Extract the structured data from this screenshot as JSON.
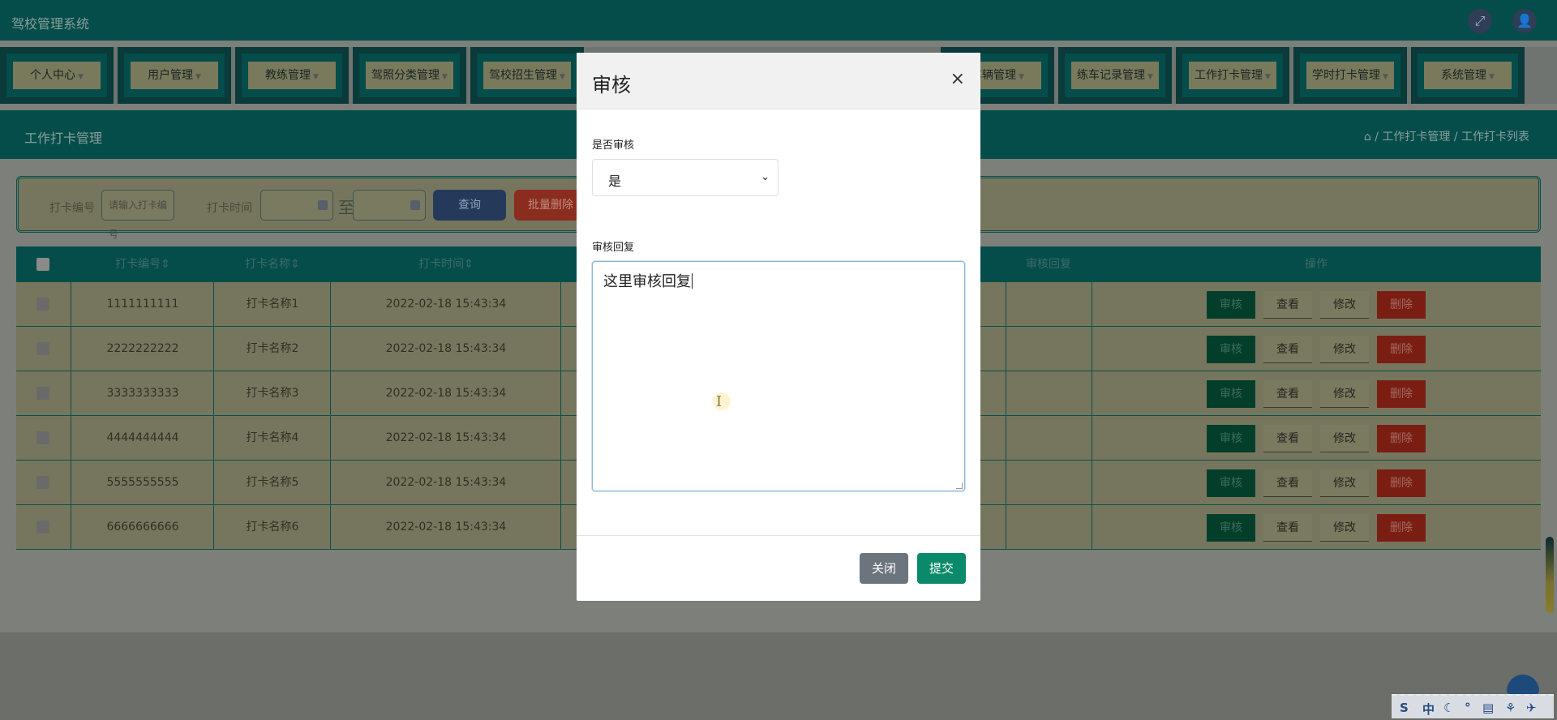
{
  "app": {
    "title": "驾校管理系统"
  },
  "topbar": {
    "fullscreen_icon": "⤢",
    "user_icon": "👤"
  },
  "nav": [
    {
      "label": "个人中心"
    },
    {
      "label": "用户管理"
    },
    {
      "label": "教练管理"
    },
    {
      "label": "驾照分类管理"
    },
    {
      "label": "驾校招生管理"
    },
    {
      "label": "车辆管理"
    },
    {
      "label": "练车记录管理"
    },
    {
      "label": "工作打卡管理"
    },
    {
      "label": "学时打卡管理"
    },
    {
      "label": "系统管理"
    }
  ],
  "page": {
    "title": "工作打卡管理",
    "breadcrumb_home_icon": "⌂",
    "breadcrumb_sep": "/",
    "breadcrumb_1": "工作打卡管理",
    "breadcrumb_2": "工作打卡列表"
  },
  "search": {
    "id_label": "打卡编号",
    "id_placeholder": "请输入打卡编号",
    "time_label": "打卡时间",
    "to_text": "至",
    "query_button": "查询",
    "batch_delete_button": "批量删除"
  },
  "table": {
    "headers": {
      "id": "打卡编号",
      "name": "打卡名称",
      "time": "打卡时间",
      "reply": "审核回复",
      "actions": "操作"
    },
    "sort_glyph": "⇕",
    "rows": [
      {
        "id": "1111111111",
        "name": "打卡名称1",
        "time": "2022-02-18 15:43:34"
      },
      {
        "id": "2222222222",
        "name": "打卡名称2",
        "time": "2022-02-18 15:43:34"
      },
      {
        "id": "3333333333",
        "name": "打卡名称3",
        "time": "2022-02-18 15:43:34"
      },
      {
        "id": "4444444444",
        "name": "打卡名称4",
        "time": "2022-02-18 15:43:34"
      },
      {
        "id": "5555555555",
        "name": "打卡名称5",
        "time": "2022-02-18 15:43:34"
      },
      {
        "id": "6666666666",
        "name": "打卡名称6",
        "time": "2022-02-18 15:43:34"
      }
    ],
    "row_actions": {
      "audit": "审核",
      "view": "查看",
      "edit": "修改",
      "delete": "删除"
    }
  },
  "modal": {
    "title": "审核",
    "close_glyph": "×",
    "status_label": "是否审核",
    "status_value": "是",
    "reply_label": "审核回复",
    "reply_value": "这里审核回复",
    "close_button": "关闭",
    "submit_button": "提交"
  },
  "ime": {
    "items": [
      "S",
      "中",
      "☾",
      "°",
      "▤",
      "⚘",
      "✈"
    ]
  },
  "colors": {
    "modal_submit": "#0a8a6a",
    "modal_close": "#6c757d",
    "header_teal": "#044d4b",
    "textarea_focus": "#86b7d8"
  }
}
